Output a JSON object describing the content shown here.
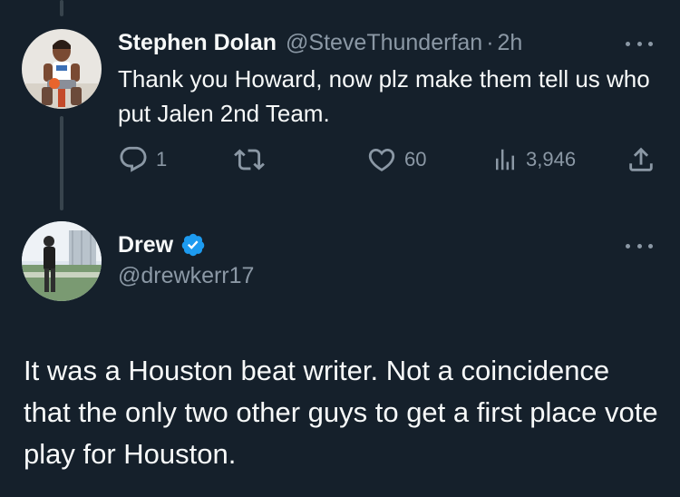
{
  "parent_tweet": {
    "display_name": "Stephen Dolan",
    "handle": "@SteveThunderfan",
    "separator": "·",
    "time": "2h",
    "text": "Thank you Howard, now plz make them tell us who put Jalen 2nd Team.",
    "replies": "1",
    "retweets": "",
    "likes": "60",
    "views": "3,946",
    "icons": {
      "more": "more-icon",
      "reply": "reply-icon",
      "retweet": "retweet-icon",
      "like": "heart-icon",
      "views": "views-icon",
      "share": "share-icon"
    }
  },
  "reply_tweet": {
    "display_name": "Drew",
    "verified": true,
    "handle": "@drewkerr17",
    "text": "It was a Houston beat writer. Not a coincidence that the only two other guys to get a first place vote play for Houston.",
    "icons": {
      "verified": "verified-badge-icon",
      "more": "more-icon"
    }
  },
  "colors": {
    "background": "#15202b",
    "primary_text": "#f7f9f9",
    "secondary_text": "#8b98a5",
    "thread_line": "#38444d",
    "verified_blue": "#1d9bf0"
  }
}
